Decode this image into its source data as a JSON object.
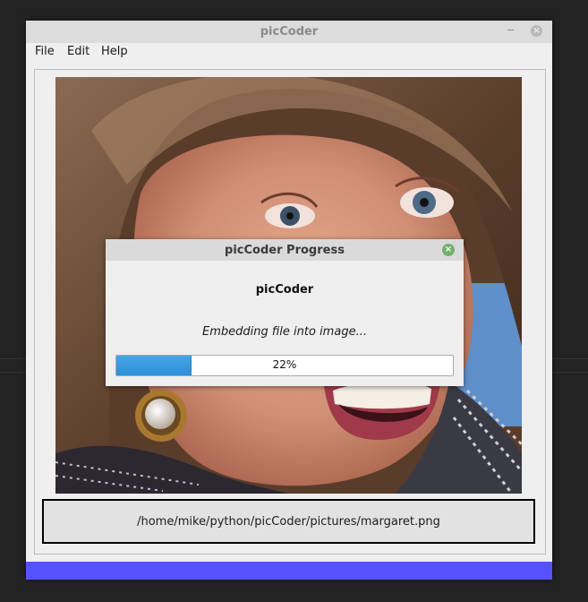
{
  "window": {
    "title": "picCoder",
    "close_glyph": "×"
  },
  "menubar": {
    "items": [
      "File",
      "Edit",
      "Help"
    ]
  },
  "image": {
    "description_icon": "photo-preview"
  },
  "path_box": {
    "text": "/home/mike/python/picCoder/pictures/margaret.png"
  },
  "dialog": {
    "title": "picCoder Progress",
    "close_glyph": "×",
    "heading": "picCoder",
    "message": "Embedding file into image...",
    "progress_value": 22,
    "progress_text": "22%"
  },
  "colors": {
    "statusbar": "#5652ff",
    "progress_fill": "#3d9ee0",
    "dialog_close": "#72b26a"
  }
}
